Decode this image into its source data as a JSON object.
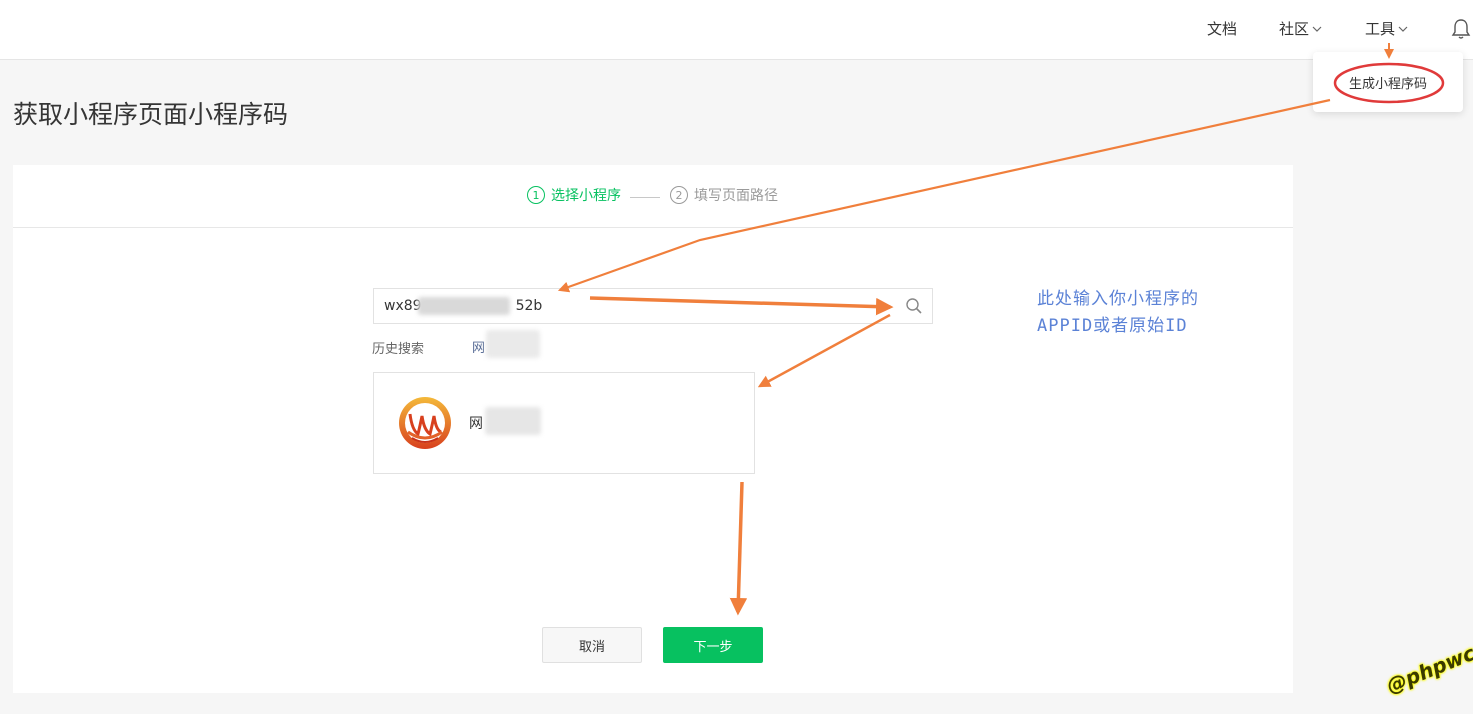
{
  "nav": {
    "docs": "文档",
    "community": "社区",
    "tools": "工具"
  },
  "tools_menu": {
    "generate_code": "生成小程序码"
  },
  "page": {
    "title": "获取小程序页面小程序码"
  },
  "steps": [
    {
      "number": "1",
      "label": "选择小程序",
      "state": "active"
    },
    {
      "number": "2",
      "label": "填写页面路径",
      "state": "inactive"
    }
  ],
  "search": {
    "value_start": "wx89",
    "value_end": "52b"
  },
  "history": {
    "label": "历史搜索",
    "item": "网"
  },
  "result": {
    "name": "网"
  },
  "buttons": {
    "cancel": "取消",
    "next": "下一步"
  },
  "annotation": {
    "line1": "此处输入你小程序的",
    "line2": "APPID或者原始ID"
  },
  "watermark": "@phpwc",
  "colors": {
    "accent_green": "#07c160",
    "arrow_orange": "#f07f3c",
    "highlight_red": "#e03a3a",
    "annotation_blue": "#5b82d6"
  }
}
